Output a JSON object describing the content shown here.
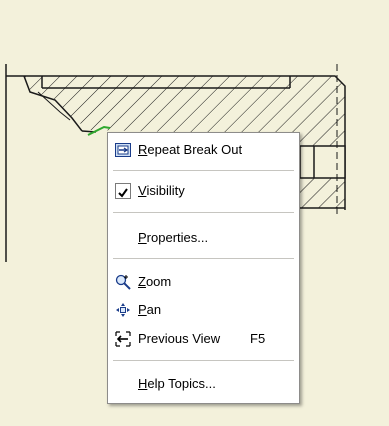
{
  "context_menu": {
    "items": [
      {
        "label": "Repeat Break Out",
        "icon": "repeat-break-out-icon",
        "mnemonic": "R"
      },
      {
        "label": "Visibility",
        "checked": true,
        "mnemonic": "V"
      },
      {
        "label": "Properties...",
        "mnemonic": "P",
        "highlighted": true
      },
      {
        "label": "Zoom",
        "icon": "zoom-icon",
        "mnemonic": "Z"
      },
      {
        "label": "Pan",
        "icon": "pan-icon",
        "mnemonic": "P"
      },
      {
        "label": "Previous View",
        "icon": "previous-view-icon",
        "shortcut": "F5"
      },
      {
        "label": "Help Topics...",
        "mnemonic": "H"
      }
    ]
  },
  "colors": {
    "background": "#f3f1db",
    "highlight_ring": "#e01b1b",
    "break_out_edge": "#2ea82e"
  }
}
